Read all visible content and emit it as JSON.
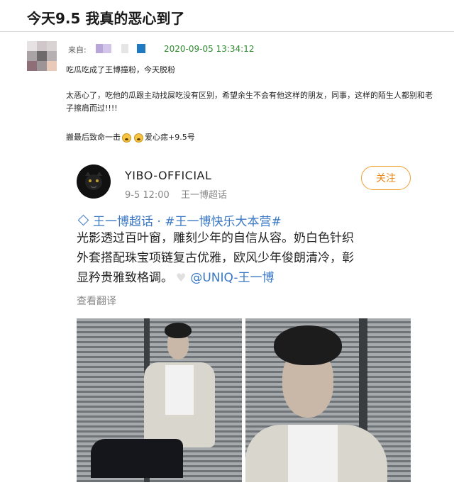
{
  "header": {
    "title": "今天9.5 我真的恶心到了"
  },
  "meta": {
    "from_label": "来自:",
    "timestamp": "2020-09-05 13:34:12"
  },
  "comment": {
    "p1": "吃瓜吃成了王博撞粉，今天脱粉",
    "p2": "太恶心了，吃他的瓜跟主动找屎吃没有区别，希望余生不会有他这样的朋友，同事，这样的陌生人都别和老子擦肩而过!!!!",
    "p3_a": "搬最后致命一击",
    "p3_b": "爱心痣+9.5号"
  },
  "post": {
    "author": "YIBO-OFFICIAL",
    "time": "9-5 12:00",
    "source": "王一博超话",
    "follow_label": "关注",
    "tags": "王一博超话 · #王一博快乐大本营#",
    "body_line1": "光影透过百叶窗，雕刻少年的自信从容。奶白色针织",
    "body_line2": "外套搭配珠宝项链复古优雅，欧风少年俊朗清冷，彰",
    "body_line3_a": "显矜贵雅致格调。",
    "mention": "@UNIQ-王一博",
    "translate_label": "查看翻译"
  },
  "colors": {
    "accent_link": "#3a78c4",
    "follow": "#e8891a",
    "timestamp": "#2f8a2f"
  }
}
